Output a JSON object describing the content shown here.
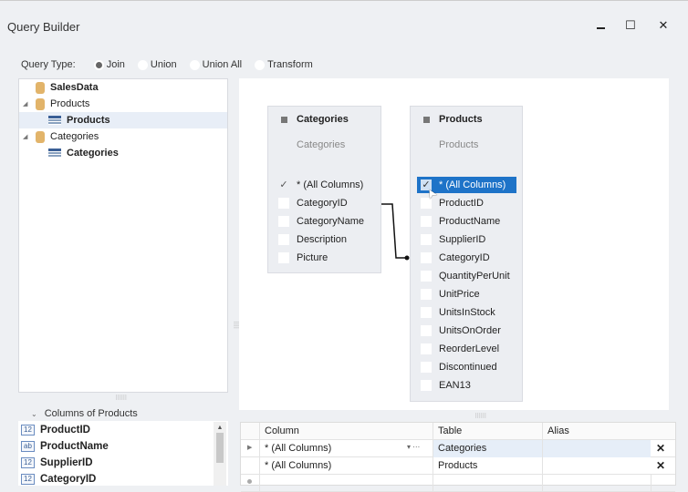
{
  "window": {
    "title": "Query Builder",
    "minimize": "▬",
    "maximize": "☐",
    "close": "✕"
  },
  "query_type": {
    "label": "Query Type:",
    "options": [
      {
        "label": "Join",
        "selected": true
      },
      {
        "label": "Union",
        "selected": false
      },
      {
        "label": "Union All",
        "selected": false
      },
      {
        "label": "Transform",
        "selected": false
      }
    ]
  },
  "tree": [
    {
      "label": "SalesData",
      "bold": true
    },
    {
      "label": "Products",
      "bold": false
    },
    {
      "label": "Products",
      "bold": true
    },
    {
      "label": "Categories",
      "bold": false
    },
    {
      "label": "Categories",
      "bold": true
    }
  ],
  "tables": [
    {
      "name": "Categories",
      "alias": "Categories",
      "columns": [
        {
          "label": "* (All Columns)",
          "checked": true
        },
        {
          "label": "CategoryID"
        },
        {
          "label": "CategoryName"
        },
        {
          "label": "Description"
        },
        {
          "label": "Picture"
        }
      ]
    },
    {
      "name": "Products",
      "alias": "Products",
      "columns": [
        {
          "label": "* (All Columns)",
          "checked": true
        },
        {
          "label": "ProductID"
        },
        {
          "label": "ProductName"
        },
        {
          "label": "SupplierID"
        },
        {
          "label": "CategoryID"
        },
        {
          "label": "QuantityPerUnit"
        },
        {
          "label": "UnitPrice"
        },
        {
          "label": "UnitsInStock"
        },
        {
          "label": "UnitsOnOrder"
        },
        {
          "label": "ReorderLevel"
        },
        {
          "label": "Discontinued"
        },
        {
          "label": "EAN13"
        }
      ]
    }
  ],
  "columns_panel": {
    "title": "Columns of Products",
    "items": [
      {
        "type": "12",
        "label": "ProductID"
      },
      {
        "type": "ab",
        "label": "ProductName"
      },
      {
        "type": "12",
        "label": "SupplierID"
      },
      {
        "type": "12",
        "label": "CategoryID"
      }
    ]
  },
  "grid": {
    "headers": [
      "Column",
      "Table",
      "Alias"
    ],
    "rows": [
      {
        "column": "* (All Columns)",
        "table": "Categories",
        "alias": ""
      },
      {
        "column": "* (All Columns)",
        "table": "Products",
        "alias": ""
      }
    ],
    "delete": "✕"
  }
}
